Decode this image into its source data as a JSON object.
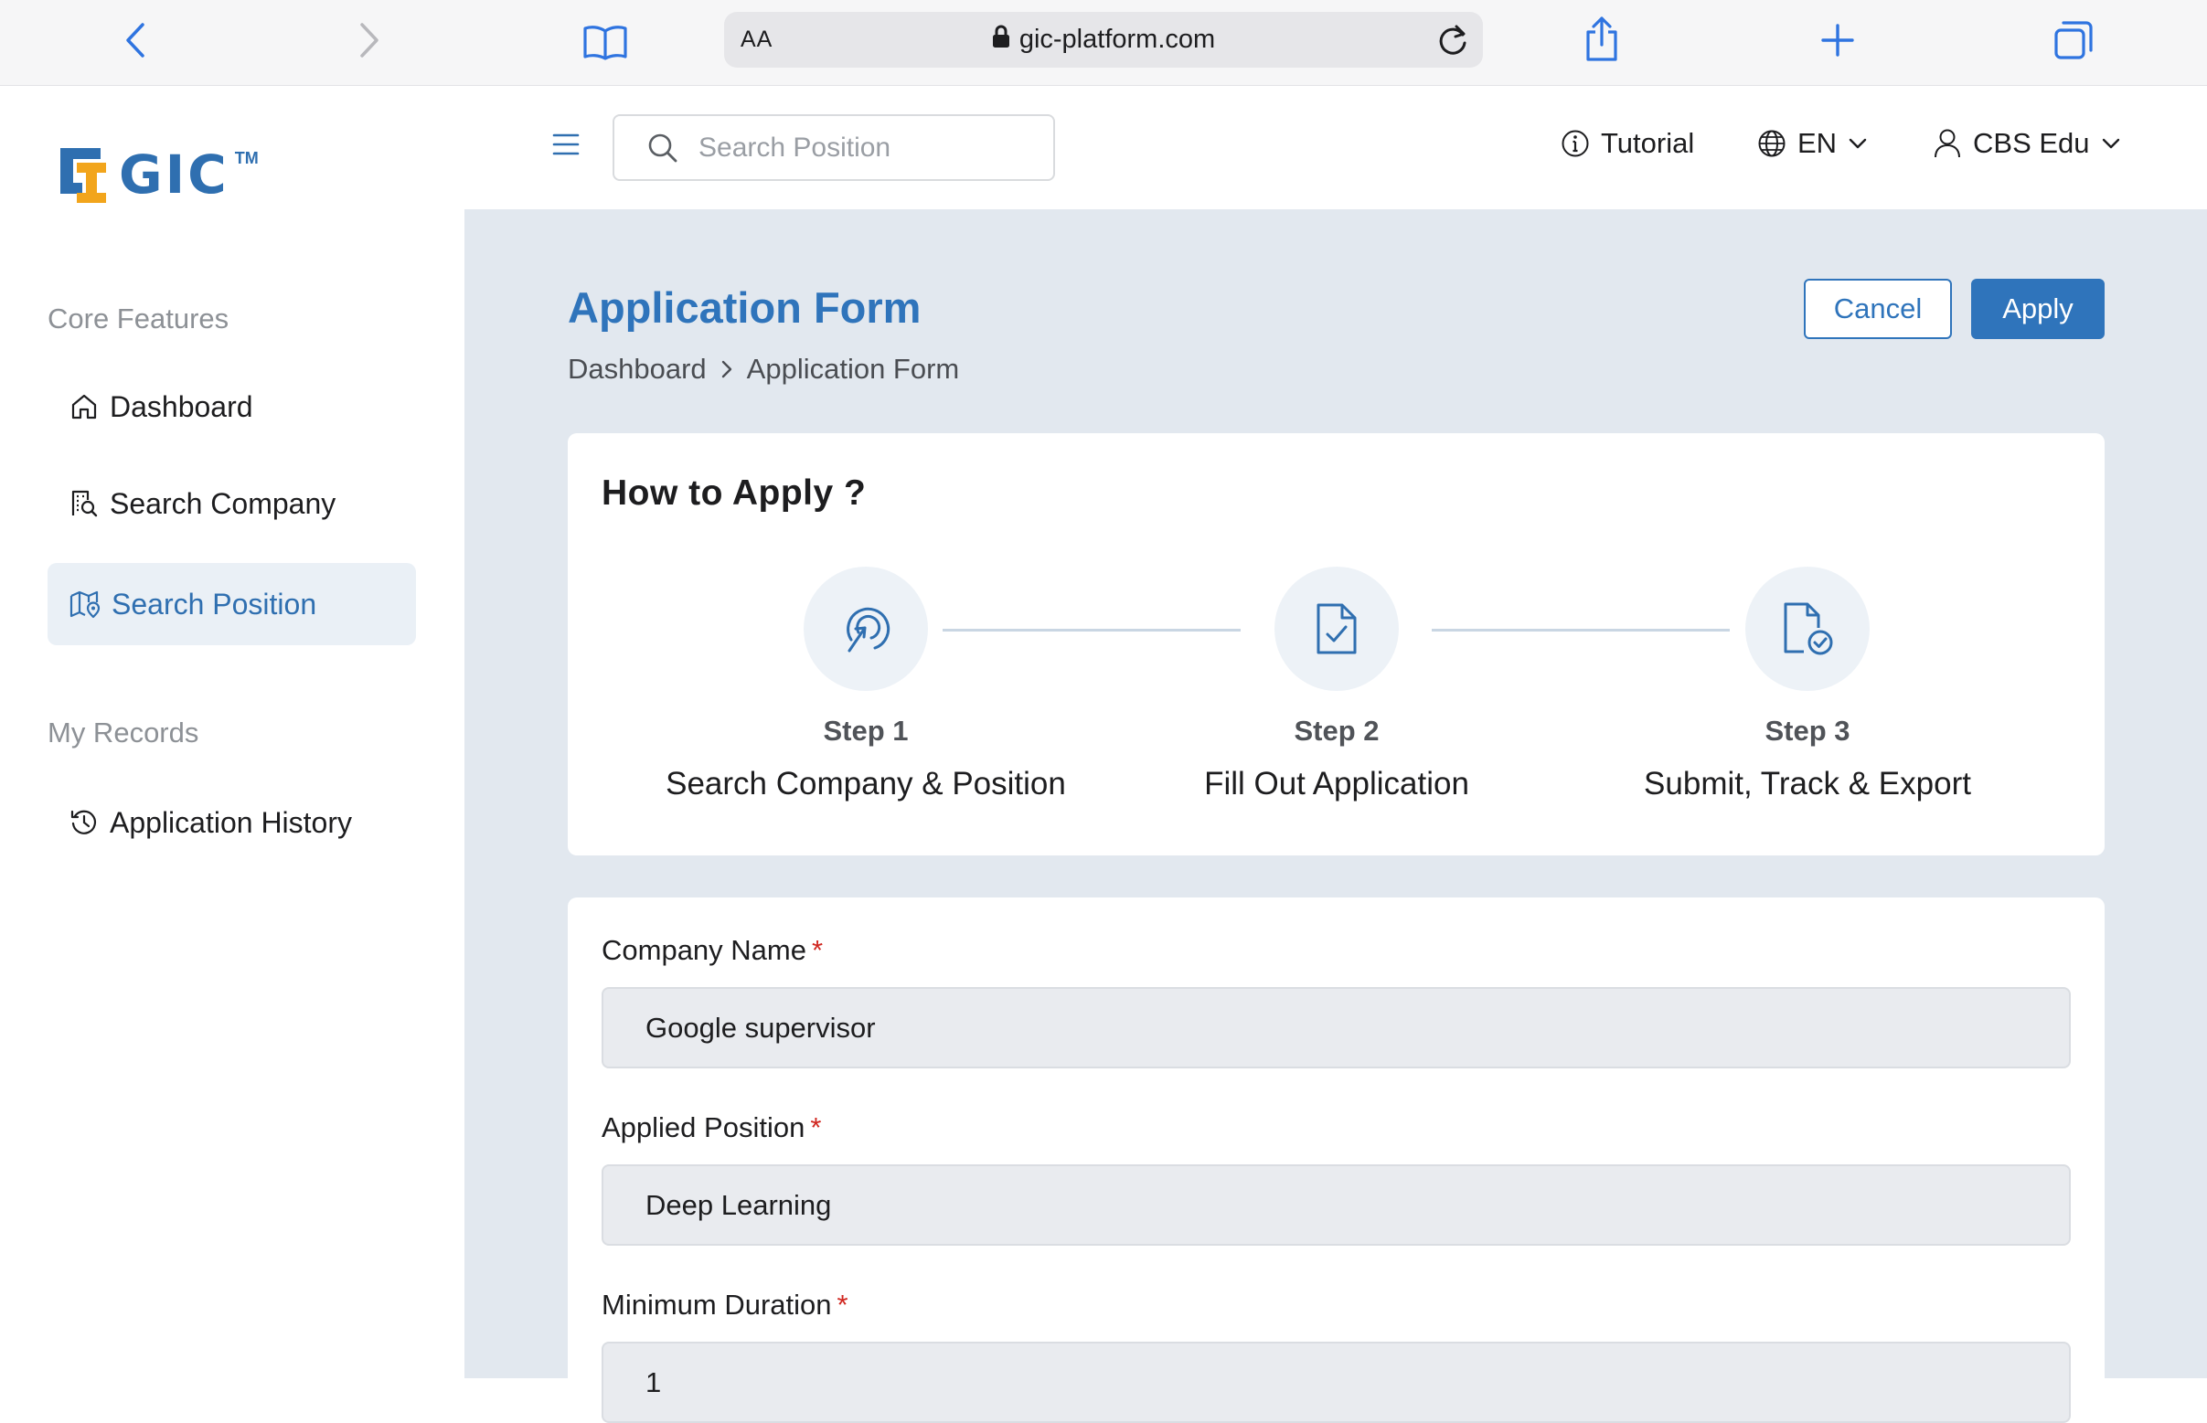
{
  "browser": {
    "aa_label": "AA",
    "url": "gic-platform.com"
  },
  "sidebar": {
    "logo_text": "GIC",
    "logo_tm": "TM",
    "sections": [
      {
        "label": "Core Features",
        "items": [
          {
            "label": "Dashboard",
            "icon": "home-icon",
            "active": false
          },
          {
            "label": "Search Company",
            "icon": "search-company-icon",
            "active": false
          },
          {
            "label": "Search Position",
            "icon": "map-pin-icon",
            "active": true
          }
        ]
      },
      {
        "label": "My Records",
        "items": [
          {
            "label": "Application History",
            "icon": "history-icon",
            "active": false
          }
        ]
      }
    ]
  },
  "header": {
    "search_placeholder": "Search Position",
    "tutorial_label": "Tutorial",
    "language": "EN",
    "user_name": "CBS Edu"
  },
  "page": {
    "title": "Application Form",
    "breadcrumb": [
      "Dashboard",
      "Application Form"
    ],
    "cancel_label": "Cancel",
    "apply_label": "Apply"
  },
  "how_to_apply": {
    "title": "How to Apply ?",
    "steps": [
      {
        "number": "Step 1",
        "description": "Search Company & Position",
        "icon": "target-cursor-icon"
      },
      {
        "number": "Step 2",
        "description": "Fill Out Application",
        "icon": "document-check-icon"
      },
      {
        "number": "Step 3",
        "description": "Submit, Track & Export",
        "icon": "document-submit-icon"
      }
    ]
  },
  "form": {
    "fields": [
      {
        "label": "Company Name",
        "required_mark": "*",
        "value": "Google supervisor"
      },
      {
        "label": "Applied Position",
        "required_mark": "*",
        "value": "Deep Learning"
      },
      {
        "label": "Minimum Duration",
        "required_mark": "*",
        "value": "1"
      }
    ]
  },
  "colors": {
    "accent": "#2f74bb",
    "main_background": "#e2e8ef",
    "required": "#d0261f"
  }
}
